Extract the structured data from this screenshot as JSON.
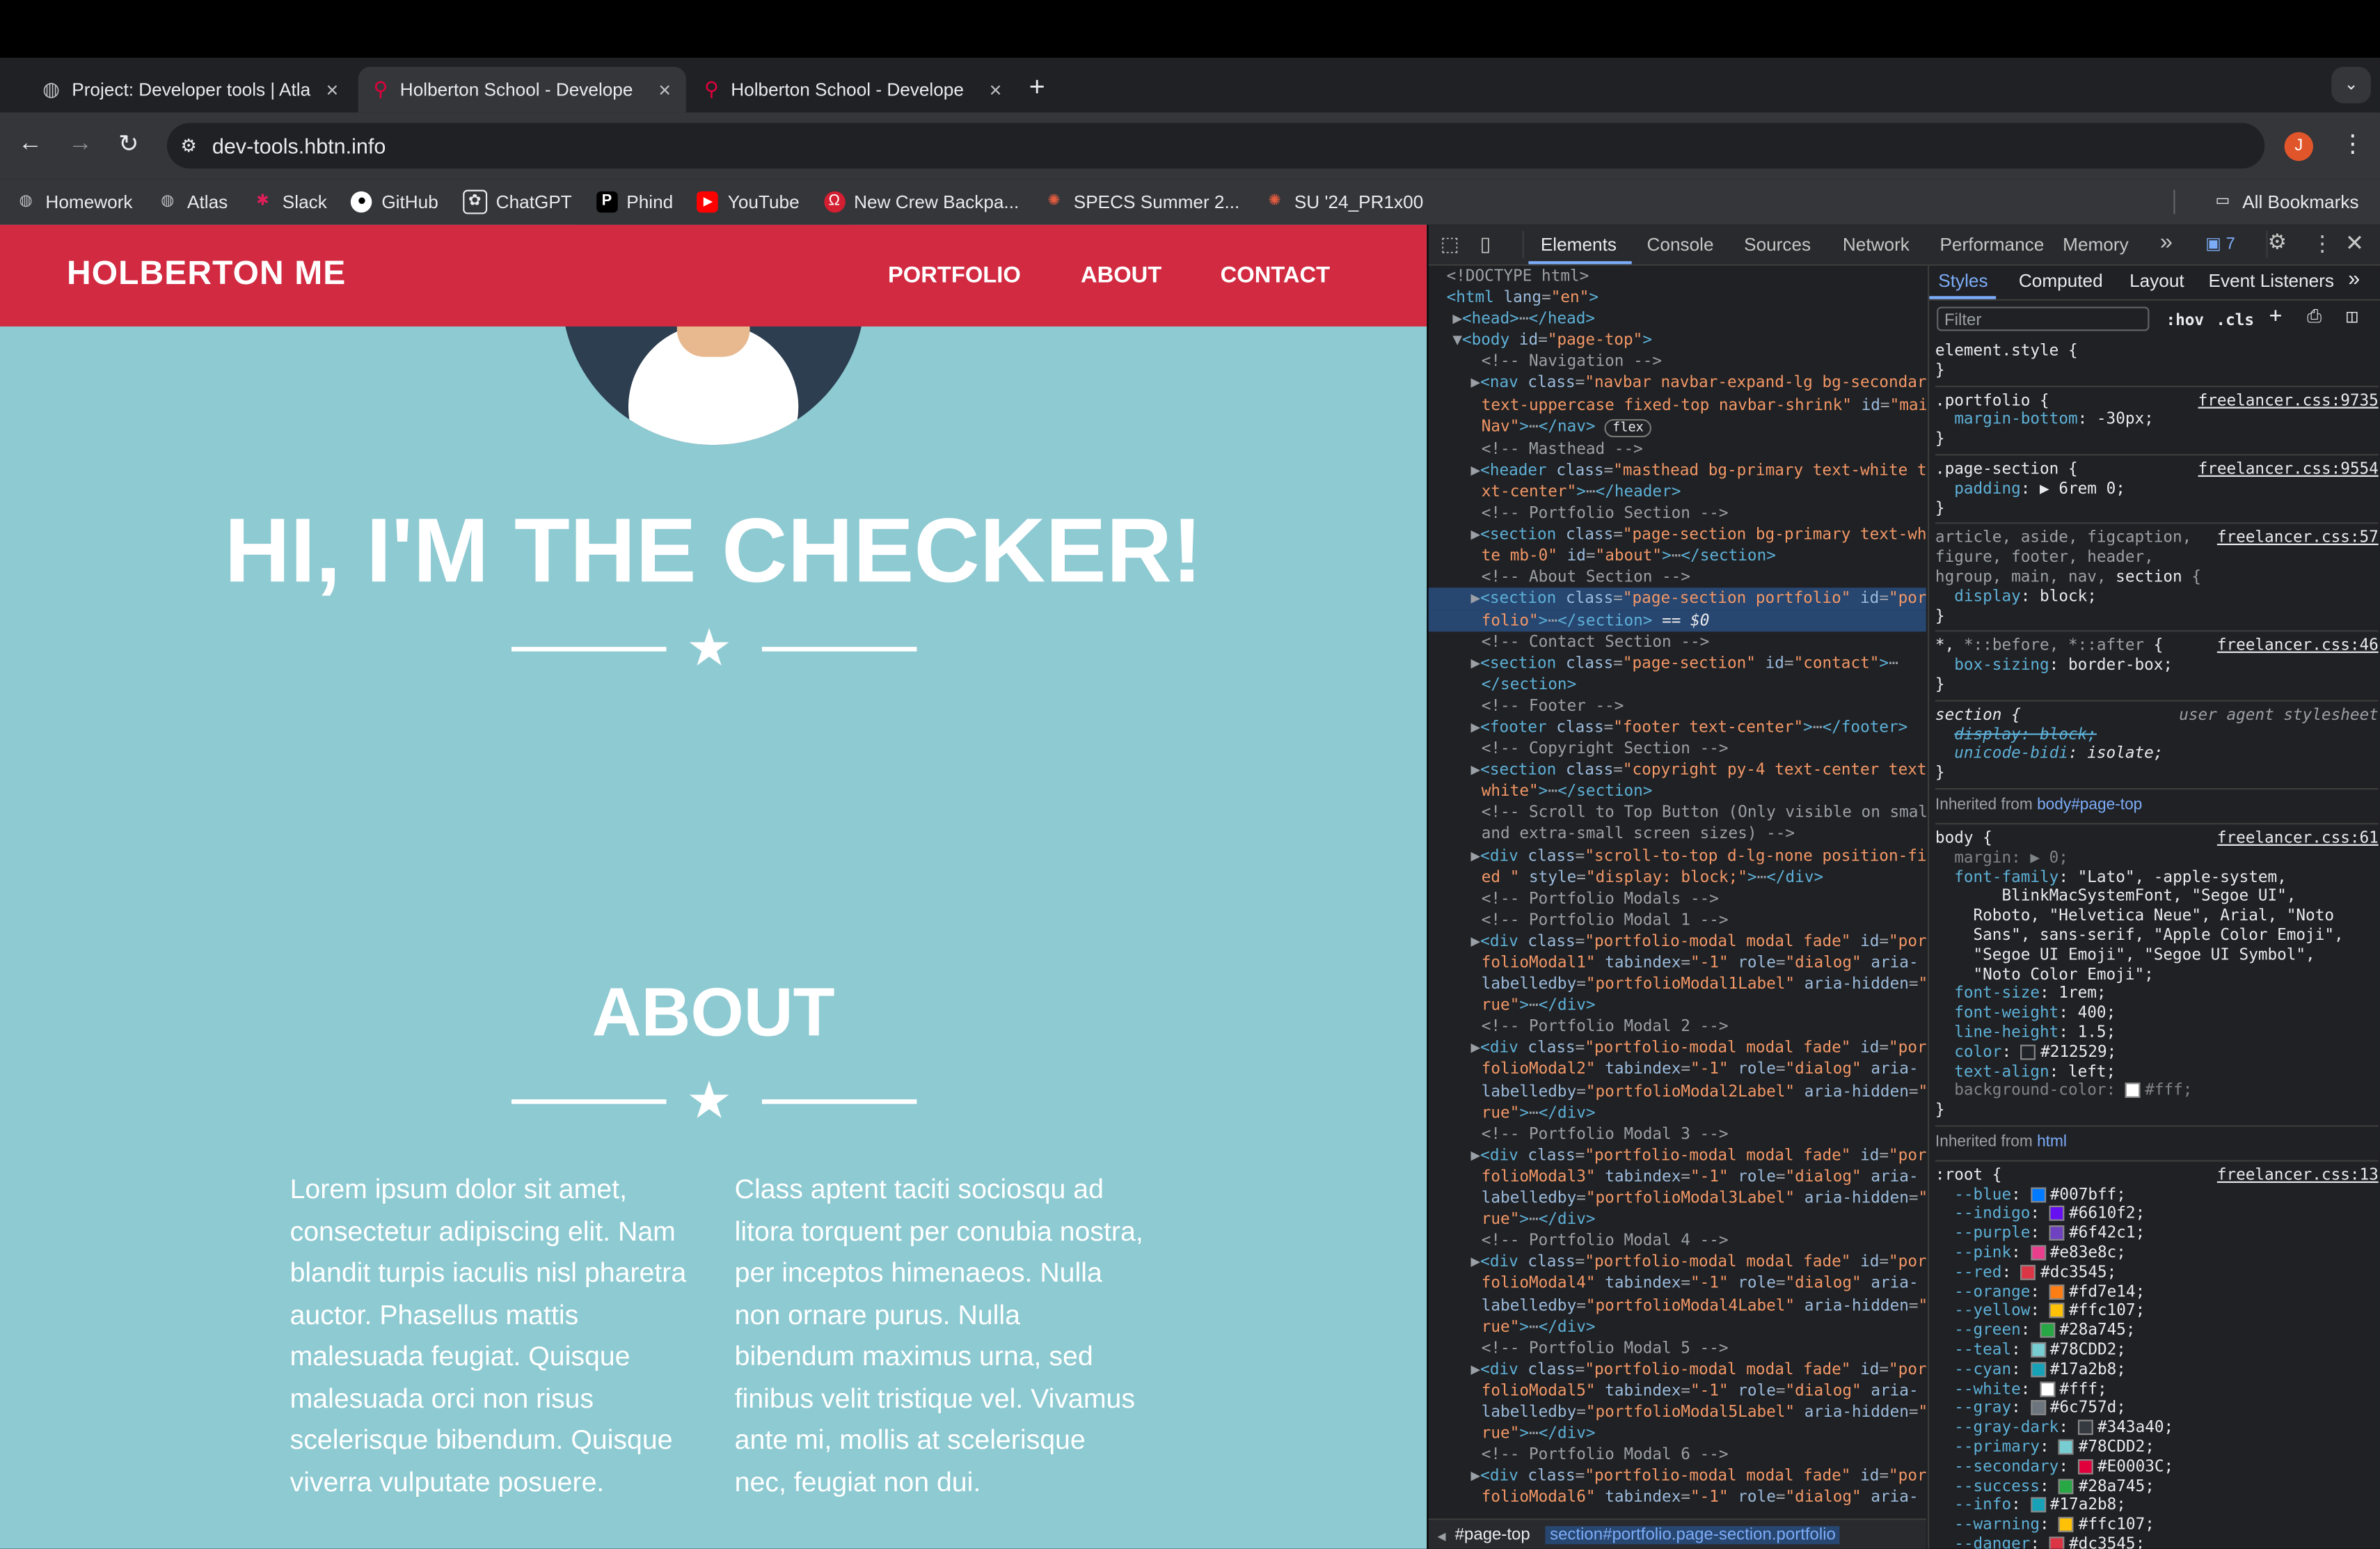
{
  "browser": {
    "tabs": [
      {
        "title": "Project: Developer tools | Atla",
        "active": false,
        "close": "×"
      },
      {
        "title": "Holberton School - Develope",
        "active": true,
        "close": "×"
      },
      {
        "title": "Holberton School - Develope",
        "active": false,
        "close": "×"
      }
    ],
    "new_tab": "+",
    "url": "dev-tools.hbtn.info",
    "profile_initial": "J",
    "bookmarks": [
      "Homework",
      "Atlas",
      "Slack",
      "GitHub",
      "ChatGPT",
      "Phind",
      "YouTube",
      "New Crew Backpa...",
      "SPECS Summer 2...",
      "SU '24_PR1x00"
    ],
    "all_bookmarks": "All Bookmarks"
  },
  "site": {
    "brand": "HOLBERTON ME",
    "nav": [
      "PORTFOLIO",
      "ABOUT",
      "CONTACT"
    ],
    "masthead_heading": "HI, I'M THE CHECKER!",
    "about_heading": "ABOUT",
    "about_left": "Lorem ipsum dolor sit amet, consectetur adipiscing elit. Nam blandit turpis iaculis nisl pharetra auctor. Phasellus mattis malesuada feugiat. Quisque malesuada orci non risus scelerisque bibendum. Quisque viverra vulputate posuere.",
    "about_right": "Class aptent taciti sociosqu ad litora torquent per conubia nostra, per inceptos himenaeos. Nulla non ornare purus. Nulla bibendum maximus urna, sed finibus velit tristique vel. Vivamus ante mi, mollis at scelerisque nec, feugiat non dui."
  },
  "devtools": {
    "tabs": [
      "Elements",
      "Console",
      "Sources",
      "Network",
      "Performance",
      "Memory"
    ],
    "more": "»",
    "issues_count": "7",
    "styles_tabs": [
      "Styles",
      "Computed",
      "Layout",
      "Event Listeners"
    ],
    "filter_placeholder": "Filter",
    "hov": ":hov",
    "cls": ".cls",
    "breadcrumb": [
      "#page-top",
      "section#portfolio.page-section.portfolio"
    ],
    "colors": {
      "blue": "#007bff",
      "indigo": "#6610f2",
      "purple": "#6f42c1",
      "pink": "#e83e8c",
      "red": "#dc3545",
      "orange": "#fd7e14",
      "yellow": "#ffc107",
      "green": "#28a745",
      "teal": "#78CDD2",
      "cyan": "#17a2b8",
      "white": "#fff",
      "gray": "#6c757d",
      "gray_dark": "#343a40",
      "primary": "#78CDD2",
      "secondary": "#E0003C",
      "success": "#28a745",
      "info": "#17a2b8",
      "warning": "#ffc107",
      "danger": "#dc3545"
    }
  }
}
